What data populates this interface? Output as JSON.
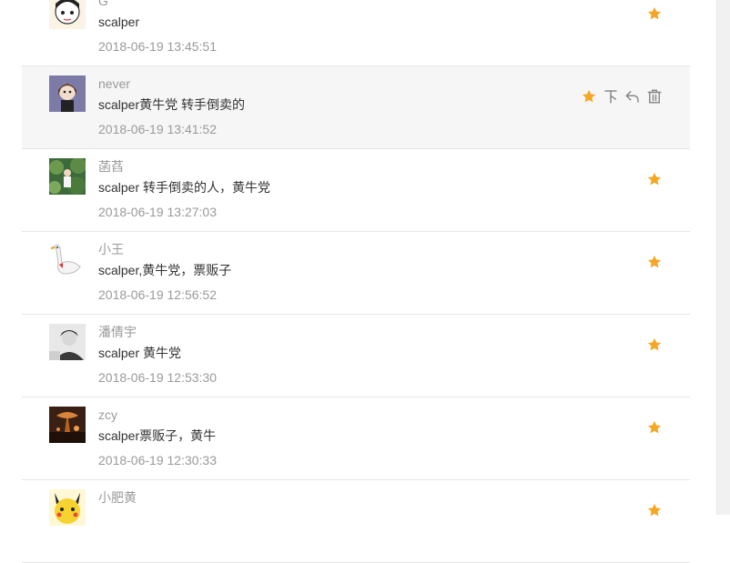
{
  "comments": [
    {
      "author": "G",
      "text": "scalper",
      "time": "2018-06-19 13:45:51"
    },
    {
      "author": "never",
      "text": "scalper黄牛党 转手倒卖的",
      "time": "2018-06-19 13:41:52"
    },
    {
      "author": "菡萏",
      "text": "scalper 转手倒卖的人，黄牛党",
      "time": "2018-06-19 13:27:03"
    },
    {
      "author": "小王",
      "text": "scalper,黄牛党，票贩子",
      "time": "2018-06-19 12:56:52"
    },
    {
      "author": "潘倩宇",
      "text": "scalper 黄牛党",
      "time": "2018-06-19 12:53:30"
    },
    {
      "author": "zcy",
      "text": "scalper票贩子，黄牛",
      "time": "2018-06-19 12:30:33"
    },
    {
      "author": "小肥黄",
      "text": "",
      "time": ""
    }
  ],
  "hovered_row_actions": [
    "star-icon",
    "pin-top-icon",
    "reply-icon",
    "delete-icon"
  ],
  "colors": {
    "star": "#f5a623",
    "icon_gray": "#8a8a8a",
    "hover_bg": "#f6f6f6",
    "divider": "#e6e6e6"
  }
}
